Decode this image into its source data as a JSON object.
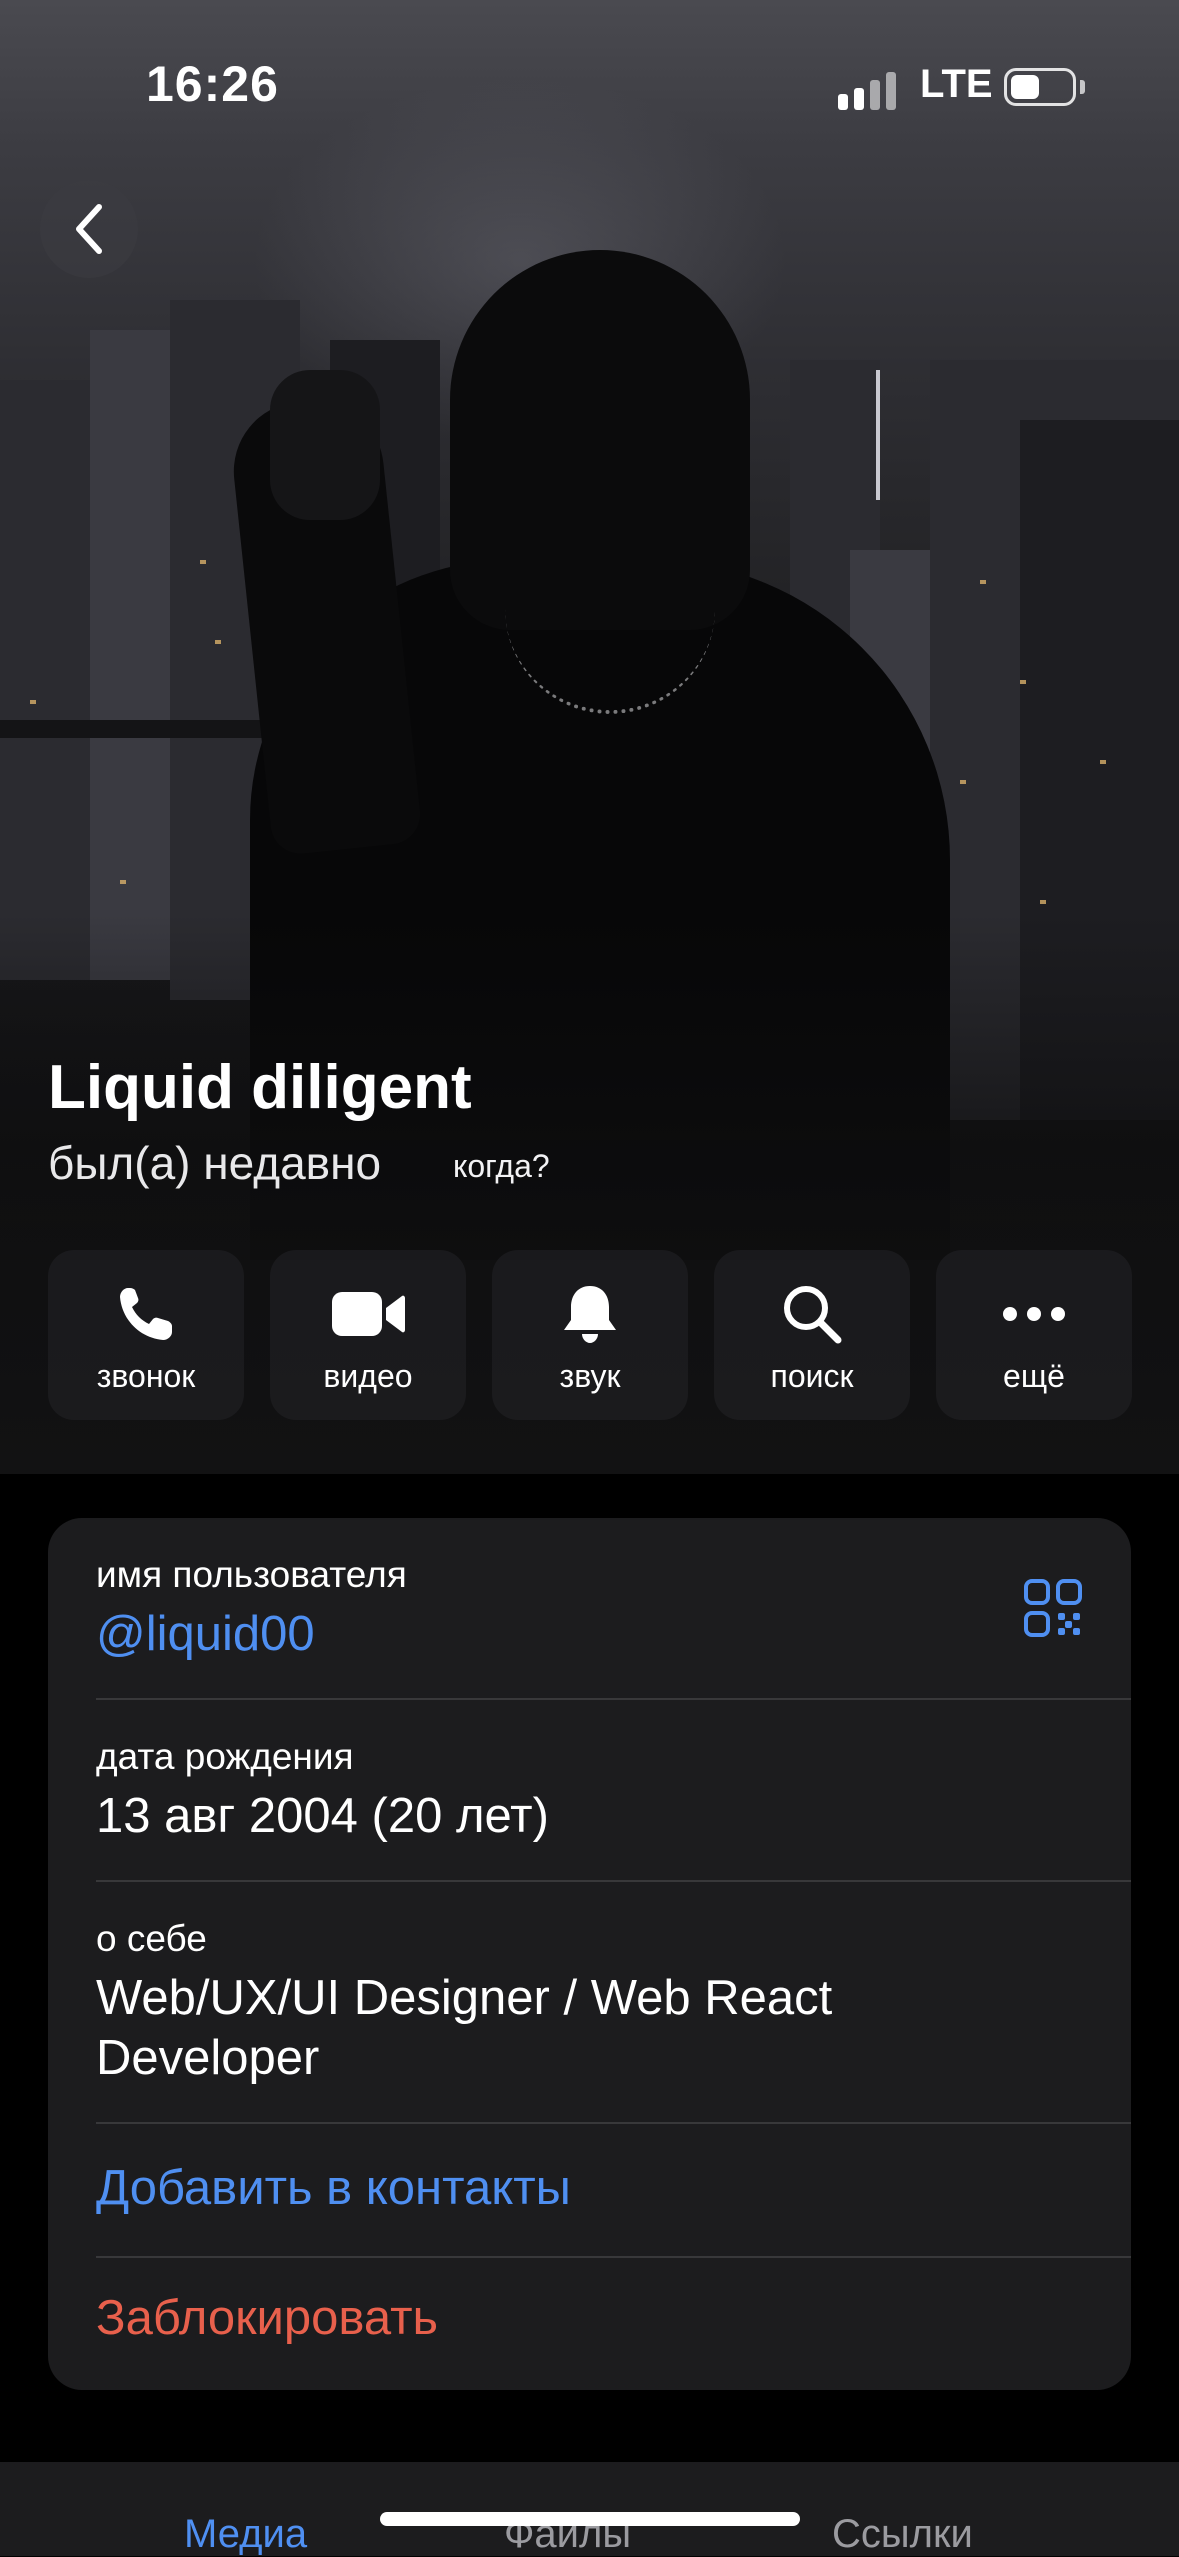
{
  "status_bar": {
    "time": "16:26",
    "network": "LTE"
  },
  "profile": {
    "name": "Liquid diligent",
    "last_seen": "был(а) недавно",
    "when_link": "когда?"
  },
  "actions": [
    {
      "label": "звонок",
      "icon": "phone-icon"
    },
    {
      "label": "видео",
      "icon": "video-icon"
    },
    {
      "label": "звук",
      "icon": "bell-icon"
    },
    {
      "label": "поиск",
      "icon": "search-icon"
    },
    {
      "label": "ещё",
      "icon": "more-icon"
    }
  ],
  "info": {
    "username_caption": "имя пользователя",
    "username": "@liquid00",
    "birthday_caption": "дата рождения",
    "birthday": "13 авг 2004 (20 лет)",
    "about_caption": "о себе",
    "about_line1": "Web/UX/UI Designer / Web React",
    "about_line2": "Developer",
    "add_contact": "Добавить в контакты",
    "block": "Заблокировать"
  },
  "tabs": [
    "Медиа",
    "Файлы",
    "Ссылки"
  ],
  "colors": {
    "accent": "#4f8ff1",
    "danger": "#e8604c",
    "card": "#1c1c1e"
  }
}
